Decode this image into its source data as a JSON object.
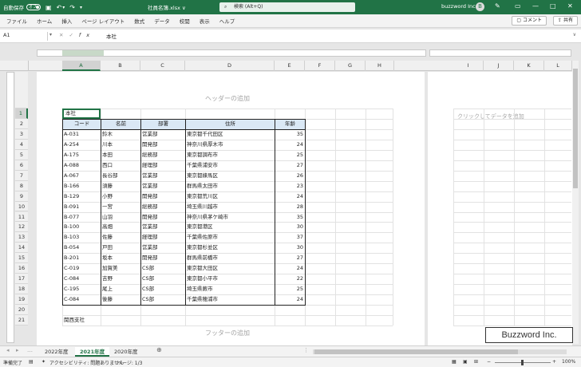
{
  "titlebar": {
    "autosave_label": "自動保存",
    "autosave_state": "オフ",
    "filename": "社員名簿.xlsx ∨",
    "search_placeholder": "検索 (Alt+Q)",
    "user": "buzzword Inc.",
    "avatar_letter": "B"
  },
  "ribbon": {
    "tabs": [
      "ファイル",
      "ホーム",
      "挿入",
      "ページ レイアウト",
      "数式",
      "データ",
      "校閲",
      "表示",
      "ヘルプ"
    ],
    "comment": "コメント",
    "share": "共有"
  },
  "formula_bar": {
    "name_box": "A1",
    "value": "本社"
  },
  "columns": [
    "A",
    "B",
    "C",
    "D",
    "E",
    "F",
    "G",
    "H",
    "I",
    "J",
    "K",
    "L"
  ],
  "rows": [
    "1",
    "2",
    "3",
    "4",
    "5",
    "6",
    "7",
    "8",
    "9",
    "10",
    "11",
    "12",
    "13",
    "14",
    "15",
    "16",
    "17",
    "18",
    "19",
    "20",
    "21"
  ],
  "page": {
    "header_placeholder": "ヘッダーの追加",
    "footer_placeholder": "フッターの追加",
    "add_data_placeholder": "クリックしてデータを追加"
  },
  "sheet": {
    "a1": "本社",
    "a21": "関西支社",
    "headers": [
      "コード",
      "名前",
      "部署",
      "住所",
      "年齢"
    ],
    "records": [
      [
        "A-031",
        "鈴木",
        "営業部",
        "東京都千代田区",
        "35"
      ],
      [
        "A-254",
        "川本",
        "開発部",
        "神奈川県厚木市",
        "24"
      ],
      [
        "A-175",
        "本田",
        "総務部",
        "東京都調布市",
        "25"
      ],
      [
        "A-088",
        "西口",
        "経理部",
        "千葉県浦安市",
        "27"
      ],
      [
        "A-067",
        "長谷部",
        "営業部",
        "東京都練馬区",
        "26"
      ],
      [
        "B-166",
        "須藤",
        "営業部",
        "群馬県太田市",
        "23"
      ],
      [
        "B-129",
        "小野",
        "開発部",
        "東京都荒川区",
        "24"
      ],
      [
        "B-091",
        "一宮",
        "総務部",
        "埼玉県川越市",
        "28"
      ],
      [
        "B-077",
        "山羽",
        "開発部",
        "神奈川県茅ケ崎市",
        "35"
      ],
      [
        "B-100",
        "高畑",
        "営業部",
        "東京都港区",
        "30"
      ],
      [
        "B-103",
        "佐藤",
        "経理部",
        "千葉県佐原市",
        "37"
      ],
      [
        "B-054",
        "戸田",
        "営業部",
        "東京都杉並区",
        "30"
      ],
      [
        "B-201",
        "坂本",
        "開発部",
        "群馬県前橋市",
        "27"
      ],
      [
        "C-019",
        "加賀美",
        "CS部",
        "東京都大田区",
        "24"
      ],
      [
        "C-084",
        "吉野",
        "CS部",
        "東京都小平市",
        "22"
      ],
      [
        "C-195",
        "尾上",
        "CS部",
        "埼玉県蕨市",
        "25"
      ],
      [
        "C-084",
        "後藤",
        "CS部",
        "千葉県穂浦市",
        "24"
      ]
    ]
  },
  "sheet_tabs": [
    "2022年度",
    "2021年度",
    "2020年度"
  ],
  "active_sheet_tab": "2021年度",
  "statusbar": {
    "mode": "準備完了",
    "accessibility": "アクセシビリティ: 問題ありません",
    "page": "ページ: 1/3",
    "zoom": "100%"
  },
  "watermark": "Buzzword Inc.",
  "colors": {
    "excel_green": "#217346",
    "header_fill": "#dae8f5",
    "placeholder_gray": "#a5a5a5"
  }
}
